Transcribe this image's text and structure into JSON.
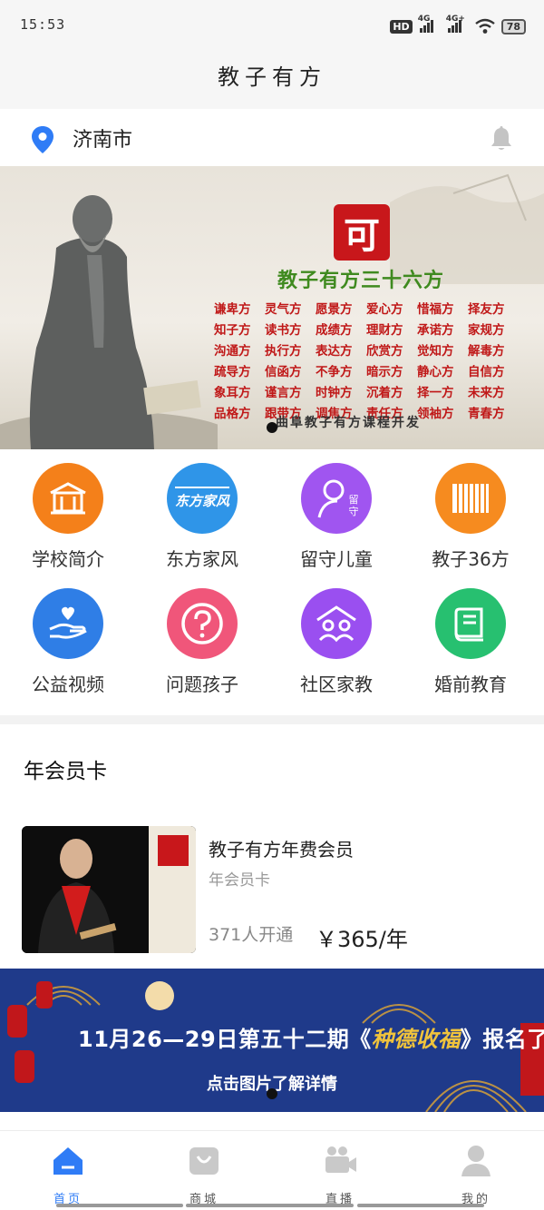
{
  "status_bar": {
    "time": "15:53",
    "hd": "HD",
    "net1": "4G",
    "net2": "4G+",
    "battery": "78"
  },
  "header": {
    "title": "教子有方"
  },
  "location": {
    "city": "济南市"
  },
  "hero_banner": {
    "logo_char": "可",
    "headline": "教子有方三十六方",
    "items": [
      "谦卑方",
      "灵气方",
      "愿景方",
      "爱心方",
      "惜福方",
      "择友方",
      "知子方",
      "读书方",
      "成绩方",
      "理财方",
      "承诺方",
      "家规方",
      "沟通方",
      "执行方",
      "表达方",
      "欣赏方",
      "觉知方",
      "解毒方",
      "疏导方",
      "信函方",
      "不争方",
      "暗示方",
      "静心方",
      "自信方",
      "象耳方",
      "谨言方",
      "时钟方",
      "沉着方",
      "择一方",
      "未来方",
      "品格方",
      "跟带方",
      "调焦方",
      "责任方",
      "领袖方",
      "青春方"
    ],
    "footer": "曲阜教子有方课程开发"
  },
  "shortcuts": [
    {
      "label": "学校简介",
      "color": "#f4801a",
      "icon": "school-icon"
    },
    {
      "label": "东方家风",
      "color": "#2f95e8",
      "icon": "family-style-icon",
      "badge": "东方家风"
    },
    {
      "label": "留守儿童",
      "color": "#a055f0",
      "icon": "child-icon",
      "badge": "留守"
    },
    {
      "label": "教子36方",
      "color": "#f68b1f",
      "icon": "scroll-icon"
    },
    {
      "label": "公益视频",
      "color": "#2f7ee6",
      "icon": "charity-icon"
    },
    {
      "label": "问题孩子",
      "color": "#f0567a",
      "icon": "question-icon"
    },
    {
      "label": "社区家教",
      "color": "#9a4ff0",
      "icon": "community-icon"
    },
    {
      "label": "婚前教育",
      "color": "#27c070",
      "icon": "book-icon"
    }
  ],
  "membership": {
    "section_title": "年会员卡",
    "card": {
      "title": "教子有方年费会员",
      "subtitle": "年会员卡",
      "count": "371人开通",
      "price": "￥365/年"
    }
  },
  "promo": {
    "headline_pre": "11月26—29日第五十二期《",
    "headline_em": "种德收福",
    "headline_post": "》报名了",
    "sub": "点击图片了解详情"
  },
  "tabbar": [
    {
      "label": "首页",
      "icon": "home-icon",
      "active": true
    },
    {
      "label": "商城",
      "icon": "shop-icon",
      "active": false
    },
    {
      "label": "直播",
      "icon": "live-icon",
      "active": false
    },
    {
      "label": "我的",
      "icon": "profile-icon",
      "active": false
    }
  ],
  "colors": {
    "accent": "#2f7cf6",
    "banner_red": "#c01818",
    "banner_green": "#3f8a1f",
    "promo_bg": "#1f3a8a"
  }
}
